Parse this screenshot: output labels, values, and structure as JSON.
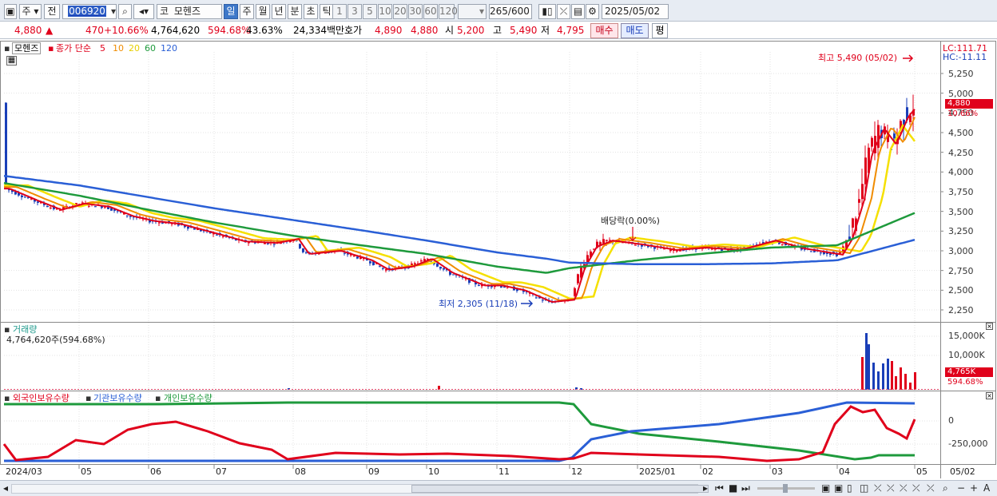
{
  "toolbar": {
    "market_label": "주",
    "prefix_label": "전",
    "stock_code": "006920",
    "exchange_label": "코",
    "stock_name": "모헨즈",
    "period_tabs": [
      "일",
      "주",
      "월",
      "년",
      "분",
      "초",
      "틱"
    ],
    "active_period": "일",
    "interval_values": [
      "1",
      "3",
      "5",
      "10",
      "20",
      "30",
      "60",
      "120"
    ],
    "count_display": "265/600",
    "date_value": "2025/05/02"
  },
  "infobar": {
    "price": "4,880",
    "change_arrow": "▲",
    "change": "470",
    "change_pct": "+10.66%",
    "volume": "4,764,620",
    "volume_pct": "594.68%",
    "turnover_pct": "43.63%",
    "amount": "24,334백만",
    "quote_label": "호가",
    "quote_ask": "4,890",
    "quote_bid": "4,880",
    "open_label": "시",
    "open": "5,200",
    "high_label": "고",
    "high": "5,490",
    "low_label": "저",
    "low": "4,795",
    "buy_label": "매수",
    "sell_label": "매도",
    "avg_label": "평"
  },
  "price_panel": {
    "title": "모헨즈",
    "ma_title": "종가 단순",
    "ma_periods": [
      "5",
      "10",
      "20",
      "60",
      "120"
    ],
    "lc_label": "LC:111.71",
    "hc_label": "HC:-11.11",
    "high_note": "최고 5,490 (05/02)",
    "low_note": "최저 2,305 (11/18)",
    "dividend_note": "배당락(0.00%)",
    "current_price_tag": "4,880",
    "current_pct_tag": "10.66%",
    "y_ticks": [
      "5,250",
      "5,000",
      "4,750",
      "4,500",
      "4,250",
      "4,000",
      "3,750",
      "3,500",
      "3,250",
      "3,000",
      "2,750",
      "2,500",
      "2,250"
    ]
  },
  "volume_panel": {
    "title": "거래량",
    "value_line": "4,764,620주(594.68%)",
    "y_ticks": [
      "15,000K",
      "10,000K"
    ],
    "current_tag": "4,765K",
    "current_pct": "594.68%"
  },
  "holdings_panel": {
    "legend": [
      "외국인보유수량",
      "기관보유수량",
      "개인보유수량"
    ],
    "y_ticks": [
      "0",
      "-250,000"
    ]
  },
  "x_axis": [
    "2024/03",
    "05",
    "06",
    "07",
    "08",
    "09",
    "10",
    "11",
    "12",
    "2025/01",
    "02",
    "03",
    "04",
    "05",
    "05/02"
  ],
  "colors": {
    "up": "#e0001b",
    "down": "#1a3fb8",
    "ma5": "#e0001b",
    "ma10": "#f08c00",
    "ma20": "#f5e000",
    "ma60": "#1e9a3c",
    "ma120": "#2a5fd6"
  },
  "chart_data": {
    "type": "line",
    "title": "모헨즈",
    "ylabel": "",
    "xlabel": "",
    "ylim": [
      2250,
      5490
    ],
    "x": [
      "2024/03",
      "2024/05",
      "2024/06",
      "2024/07",
      "2024/08",
      "2024/09",
      "2024/10",
      "2024/11",
      "2024/11/18",
      "2024/12",
      "2025/01",
      "2025/02",
      "2025/03",
      "2025/04",
      "2025/05/02"
    ],
    "series": [
      {
        "name": "종가",
        "values": [
          3780,
          3580,
          3420,
          3230,
          3050,
          2860,
          2870,
          2550,
          2305,
          3050,
          3000,
          3010,
          3080,
          3050,
          4880
        ]
      },
      {
        "name": "120",
        "values": [
          3950,
          3830,
          3680,
          3540,
          3390,
          3250,
          3130,
          2980,
          2900,
          2850,
          2830,
          2830,
          2840,
          2880,
          3140
        ]
      },
      {
        "name": "60",
        "values": [
          3860,
          3700,
          3520,
          3360,
          3190,
          3060,
          2960,
          2800,
          2720,
          2780,
          2880,
          2960,
          3040,
          3070,
          3480
        ]
      }
    ],
    "annotations": [
      {
        "text": "최고 5,490 (05/02)",
        "x": "2025/05/02",
        "y": 5490
      },
      {
        "text": "최저 2,305 (11/18)",
        "x": "2024/11/18",
        "y": 2305
      }
    ]
  }
}
